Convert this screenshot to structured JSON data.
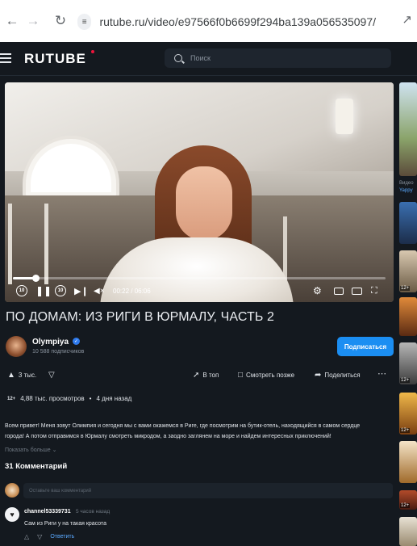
{
  "browser": {
    "url": "rutube.ru/video/e97566f0b6699f294ba139a056535097/",
    "back_icon": "arrow-left-icon",
    "forward_icon": "arrow-right-icon",
    "reload_icon": "reload-icon",
    "site_settings_icon": "tune-icon"
  },
  "header": {
    "logo": "RUTUBE",
    "search_placeholder": "Поиск",
    "accent": "#ed143b"
  },
  "player": {
    "current_time": "00:22",
    "duration": "06:06",
    "time_display": "00:22 / 06:06",
    "progress_fraction": 0.06,
    "rewind_label": "10",
    "forward_label": "10"
  },
  "video": {
    "title": "ПО ДОМАМ: ИЗ РИГИ В ЮРМАЛУ, ЧАСТЬ 2",
    "channel_name": "Olympiya",
    "subscribers": "10 588 подписчиков",
    "subscribe_label": "Подписаться",
    "likes": "3 тыс.",
    "top_label": "В топ",
    "watch_later_label": "Смотреть позже",
    "share_label": "Поделиться",
    "age_rating": "12+",
    "views": "4,88 тыс. просмотров",
    "separator": "•",
    "published": "4 дня назад",
    "description_line1": "Всем привет! Меня зовут Олимпия и сегодня мы с вами окажемся в Риге, где посмотрим на бутик-отель, находящийся в самом сердце",
    "description_line2": "города! А потом отправимся в Юрмалу смотреть микродом, а заодно заглянем на море и найдем интересных приключений!",
    "show_more": "Показать больше ⌄"
  },
  "comments": {
    "heading": "31 Комментарий",
    "input_placeholder": "Оставьте ваш комментарий",
    "items": [
      {
        "author": "channel53339731",
        "time": "5 часов назад",
        "text": "Сам из Риги  у на  такая красота",
        "reply_label": "Ответить"
      }
    ]
  },
  "sidebar": {
    "badge": "12+",
    "text1": "Видео",
    "text2": "Yappy"
  }
}
